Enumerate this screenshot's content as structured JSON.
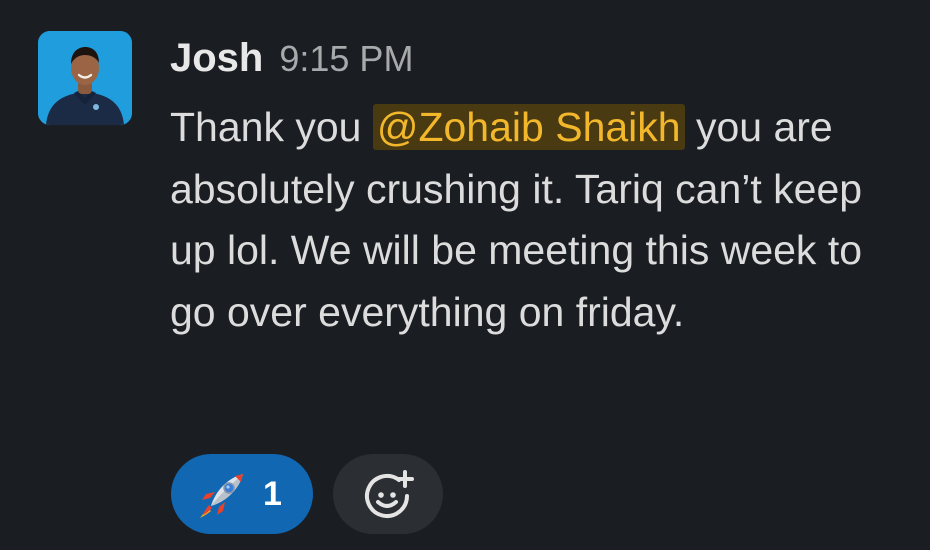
{
  "message": {
    "author": "Josh",
    "timestamp": "9:15 PM",
    "text_before_mention": "Thank you ",
    "mention": "@Zohaib Shaikh",
    "text_after_mention": " you are absolutely crushing it. Tariq can’t keep up lol. We will be meeting this week to go over everything on friday."
  },
  "reactions": [
    {
      "emoji": "rocket-icon",
      "count": "1",
      "color": "#1167b1"
    }
  ],
  "add_reaction": {
    "icon": "add-emoji-icon"
  },
  "colors": {
    "background": "#1a1d21",
    "mention_bg": "#4a3a12",
    "mention_text": "#f2b72a",
    "reaction_active": "#1167b1"
  }
}
